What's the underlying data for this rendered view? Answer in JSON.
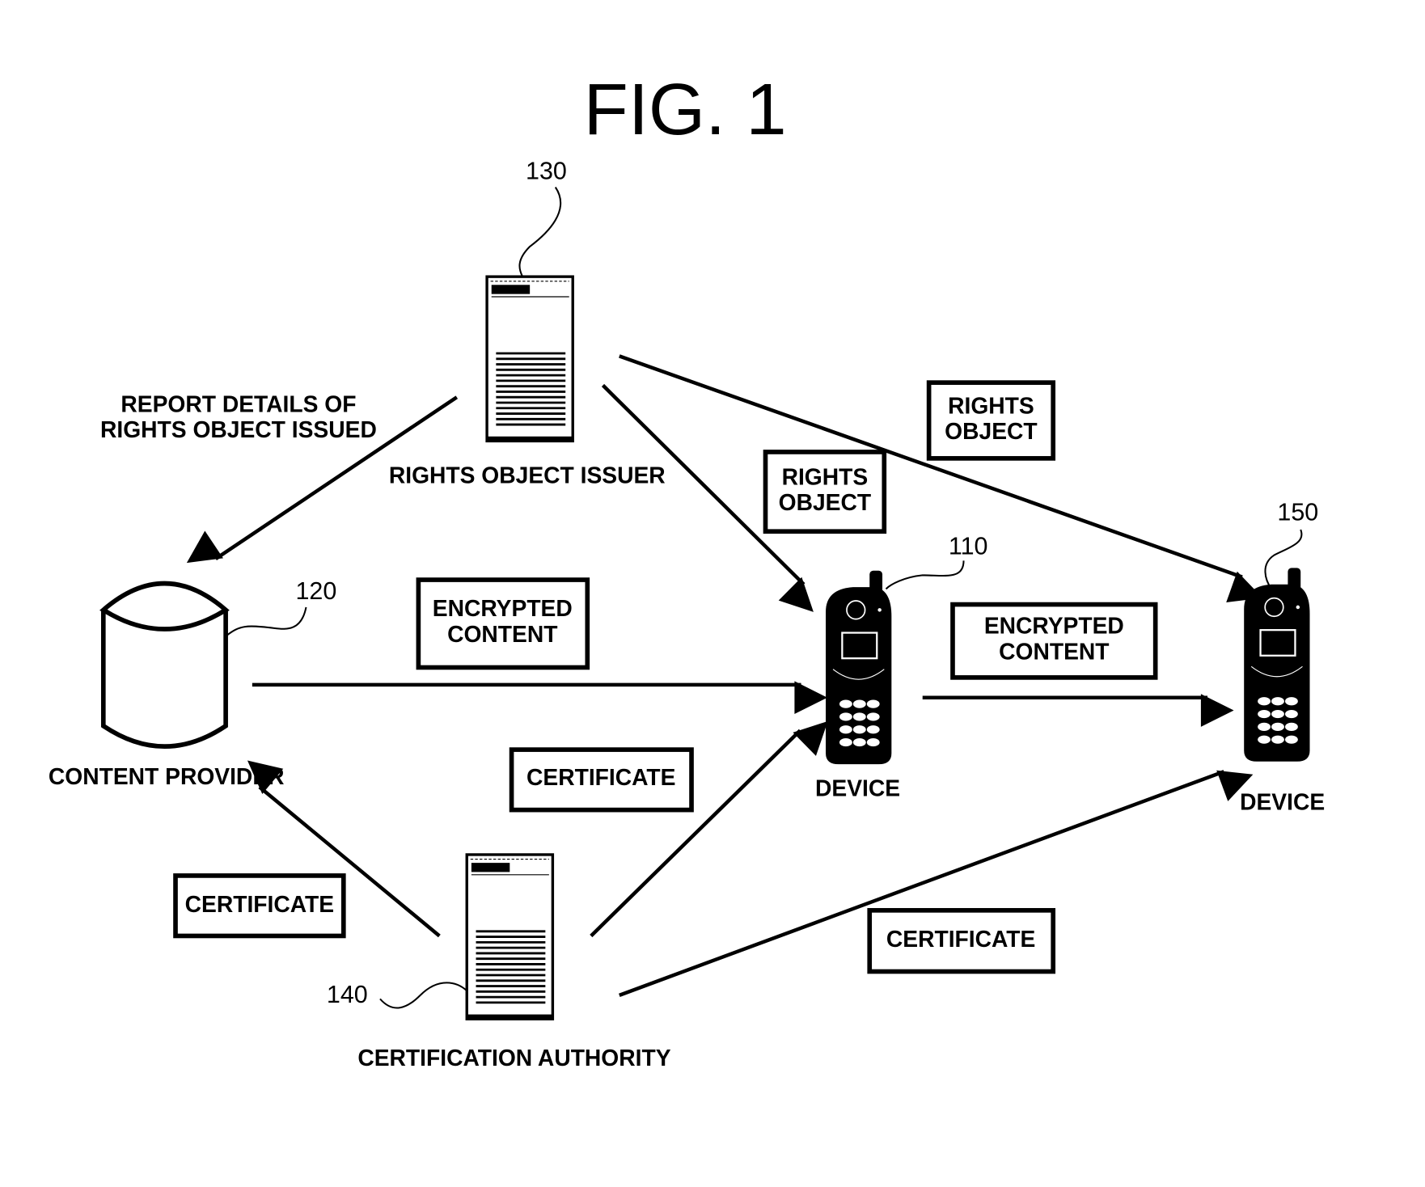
{
  "title": "FIG. 1",
  "nodes": {
    "rights_object_issuer": {
      "ref": "130",
      "label": "RIGHTS OBJECT ISSUER"
    },
    "content_provider": {
      "ref": "120",
      "label": "CONTENT PROVIDER"
    },
    "certification_authority": {
      "ref": "140",
      "label": "CERTIFICATION AUTHORITY"
    },
    "device_110": {
      "ref": "110",
      "label": "DEVICE"
    },
    "device_150": {
      "ref": "150",
      "label": "DEVICE"
    }
  },
  "edge_labels": {
    "report": [
      "REPORT DETAILS OF",
      "RIGHTS OBJECT ISSUED"
    ],
    "ro_to_110": [
      "RIGHTS",
      "OBJECT"
    ],
    "ro_to_150": [
      "RIGHTS",
      "OBJECT"
    ],
    "enc_cp_110": [
      "ENCRYPTED",
      "CONTENT"
    ],
    "enc_110_150": [
      "ENCRYPTED",
      "CONTENT"
    ],
    "cert_cp": "CERTIFICATE",
    "cert_110": "CERTIFICATE",
    "cert_150": "CERTIFICATE"
  }
}
